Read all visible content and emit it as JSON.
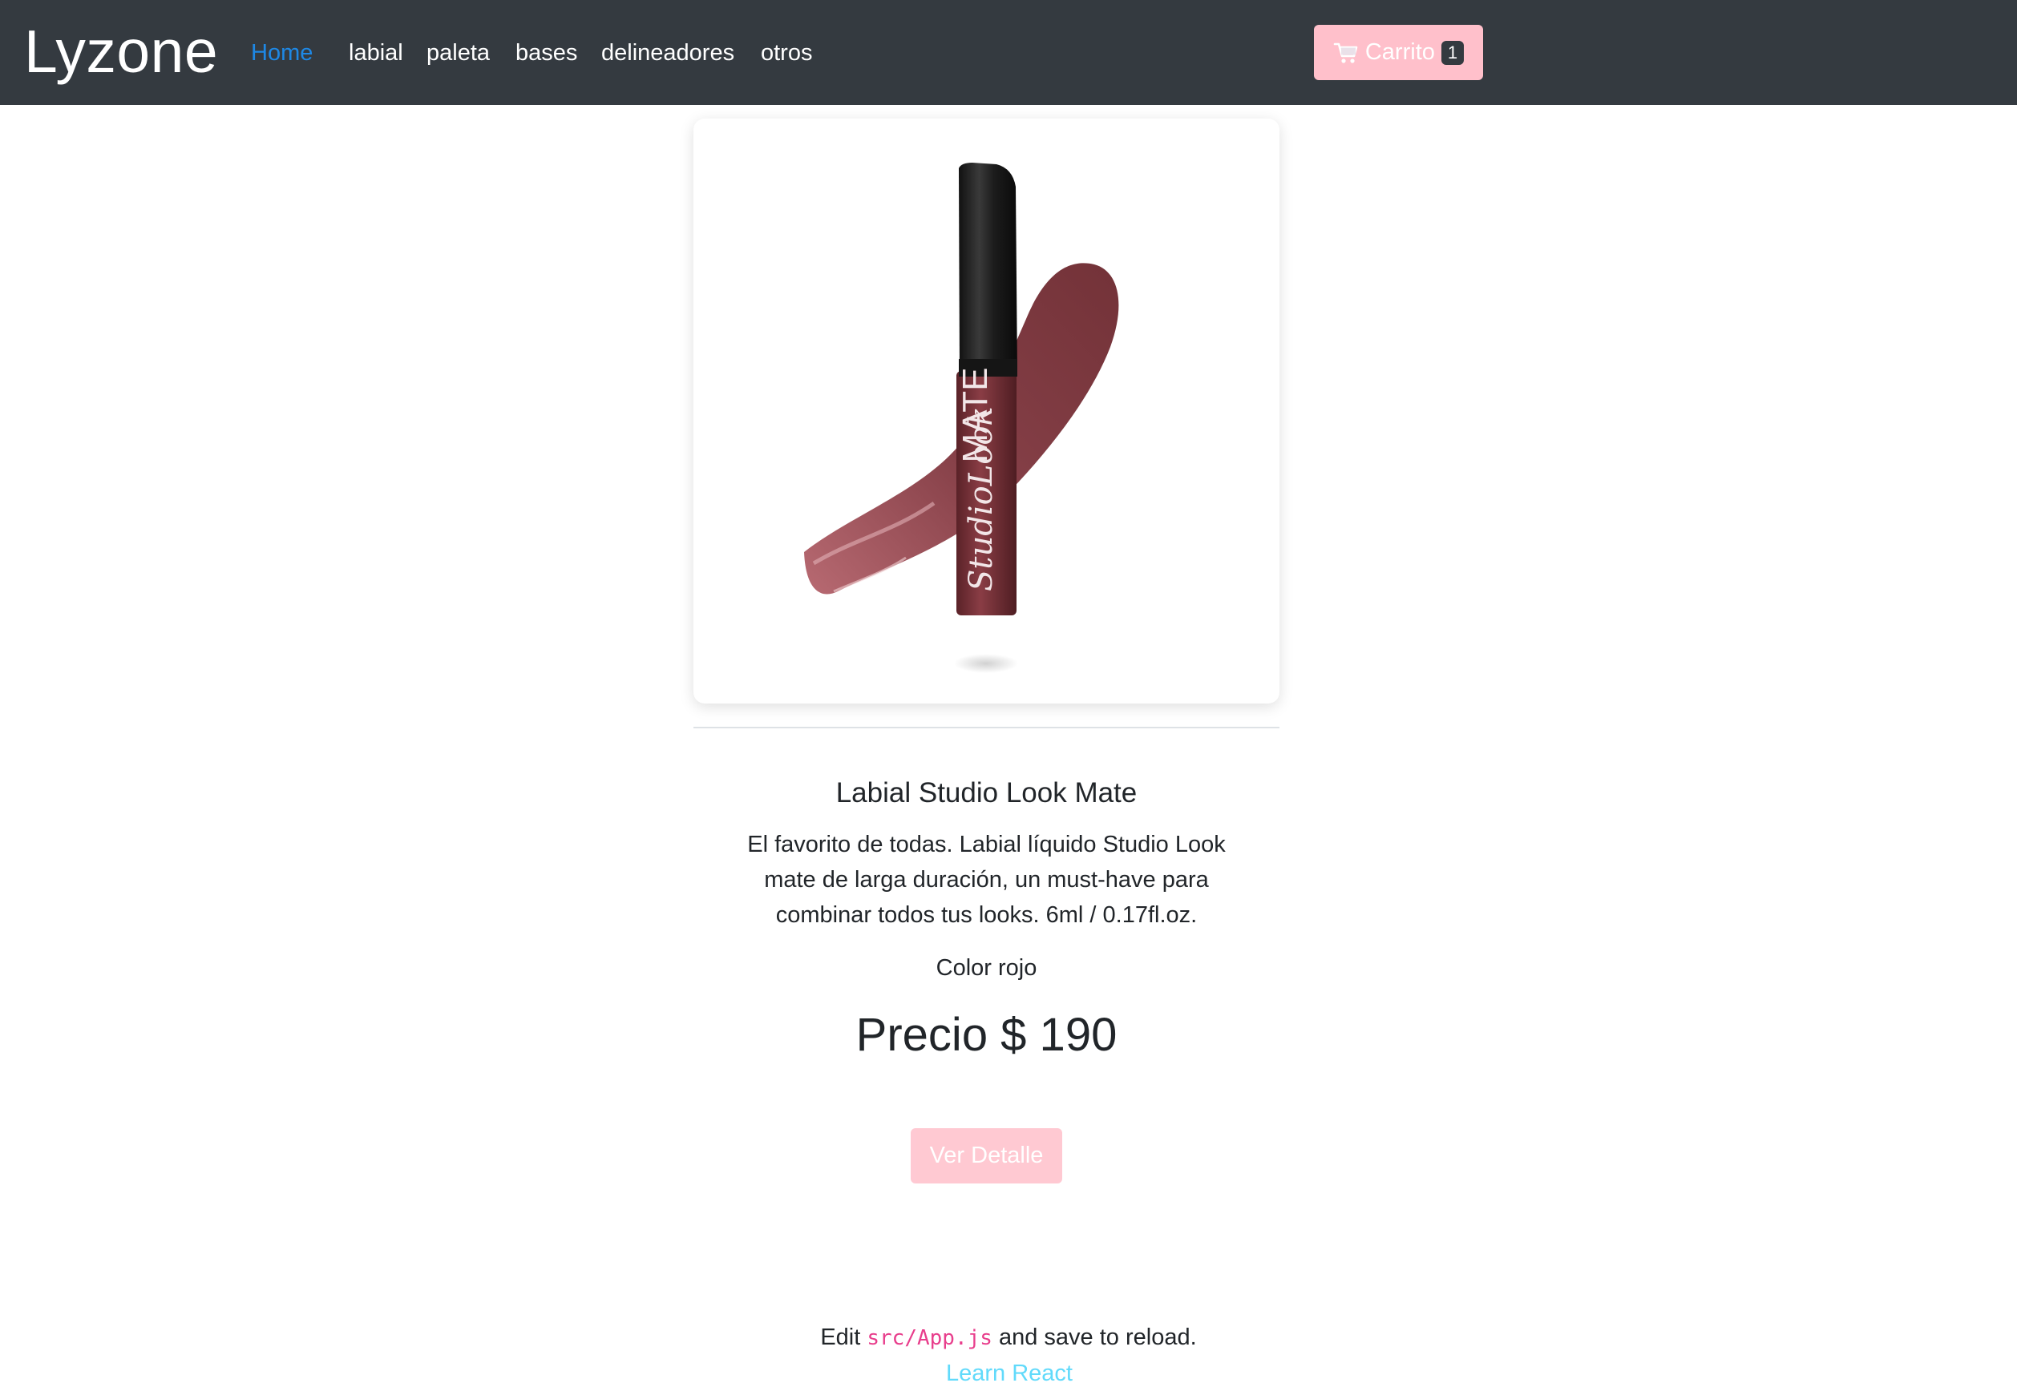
{
  "navbar": {
    "brand": "Lyzone",
    "links": [
      {
        "label": "Home",
        "active": true
      },
      {
        "label": "labial"
      },
      {
        "label": "paleta"
      },
      {
        "label": "bases"
      },
      {
        "label": "delineadores"
      },
      {
        "label": "otros"
      }
    ],
    "cart": {
      "label": "Carrito",
      "count": "1",
      "icon": "cart-icon"
    }
  },
  "product": {
    "image": {
      "brand_text": "MATE",
      "script_text": "StudioLook"
    },
    "title": "Labial Studio Look Mate",
    "description": "El favorito de todas. Labial líquido Studio Look mate de larga duración, un must-have para combinar todos tus looks. 6ml / 0.17fl.oz.",
    "color": "Color rojo",
    "price": "Precio $ 190",
    "button": "Ver Detalle"
  },
  "footer": {
    "edit_prefix": "Edit",
    "edit_code": "src/App.js",
    "edit_suffix": "and save to reload.",
    "learn_link": "Learn React"
  },
  "colors": {
    "navbar_bg": "#343a40",
    "active_link": "#1e88e5",
    "accent_pink": "#ffc0cb",
    "code": "#e83e8c",
    "link_cyan": "#61dafb",
    "lipstick": "#7d3a40"
  }
}
